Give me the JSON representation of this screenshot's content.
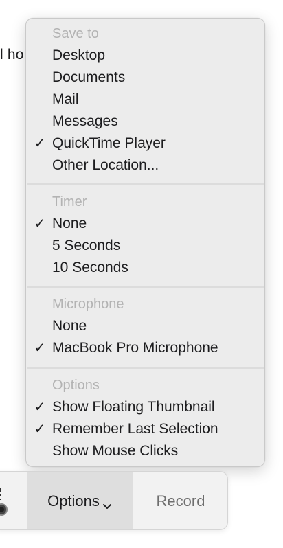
{
  "background": {
    "partial_text": "l ho"
  },
  "menu": {
    "sections": [
      {
        "header": "Save to",
        "items": [
          {
            "label": "Desktop",
            "checked": false
          },
          {
            "label": "Documents",
            "checked": false
          },
          {
            "label": "Mail",
            "checked": false
          },
          {
            "label": "Messages",
            "checked": false
          },
          {
            "label": "QuickTime Player",
            "checked": true
          },
          {
            "label": "Other Location...",
            "checked": false
          }
        ]
      },
      {
        "header": "Timer",
        "items": [
          {
            "label": "None",
            "checked": true
          },
          {
            "label": "5 Seconds",
            "checked": false
          },
          {
            "label": "10 Seconds",
            "checked": false
          }
        ]
      },
      {
        "header": "Microphone",
        "items": [
          {
            "label": "None",
            "checked": false
          },
          {
            "label": "MacBook Pro Microphone",
            "checked": true
          }
        ]
      },
      {
        "header": "Options",
        "items": [
          {
            "label": "Show Floating Thumbnail",
            "checked": true
          },
          {
            "label": "Remember Last Selection",
            "checked": true
          },
          {
            "label": "Show Mouse Clicks",
            "checked": false
          }
        ]
      }
    ],
    "checkmark": "✓"
  },
  "toolbar": {
    "options_label": "Options",
    "record_label": "Record",
    "capture_icon": "record-screen-icon"
  },
  "colors": {
    "menu_bg": "#ececec",
    "header_text": "#b3b3b3",
    "item_text": "#1d1d1f",
    "options_bg": "#dedede",
    "record_text": "#6e6e6e"
  }
}
